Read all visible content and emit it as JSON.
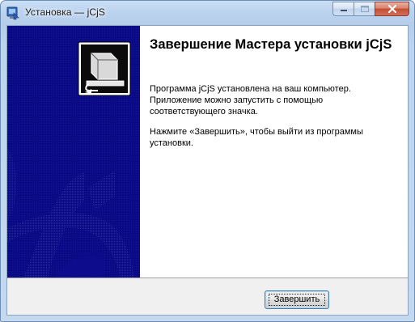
{
  "window": {
    "title": "Установка — jCjS"
  },
  "titlebar": {
    "buttons": [
      {
        "name": "minimize",
        "icon": "minimize-icon"
      },
      {
        "name": "maximize",
        "icon": "maximize-icon",
        "disabled": true
      },
      {
        "name": "close",
        "icon": "close-icon"
      }
    ]
  },
  "wizard": {
    "heading": "Завершение Мастера установки jCjS",
    "paragraph1": "Программа jCjS установлена на ваш компьютер. Приложение можно запустить с помощью соответствующего значка.",
    "paragraph2": "Нажмите «Завершить», чтобы выйти из программы установки.",
    "side_image_icon": "installer-computer-icon",
    "finish_button": {
      "label": "Завершить",
      "accelerator": "З"
    }
  },
  "colors": {
    "side_panel": "#0a0a85",
    "side_panel_accent": "#1b1bb0",
    "titlebar": "#bcd3ee",
    "close_button": "#c44c33",
    "footer": "#f0f0f0"
  }
}
